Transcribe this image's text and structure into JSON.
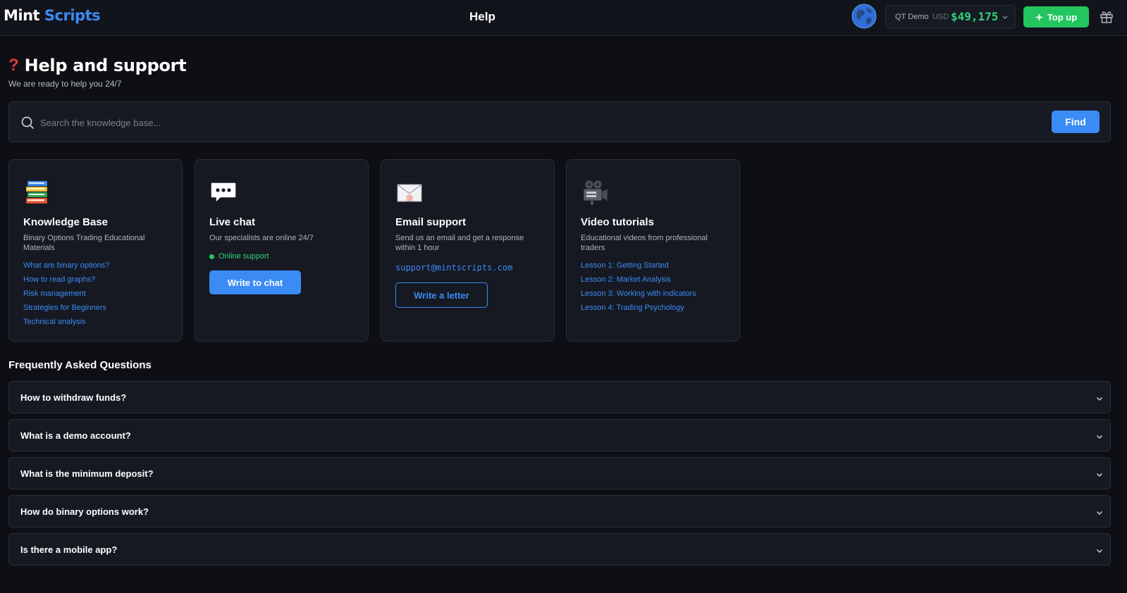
{
  "header": {
    "brand_part1": "Mint",
    "brand_part2": "Scripts",
    "page_title": "Help",
    "account_label": "QT Demo",
    "currency": "USD",
    "balance": "$49,175",
    "topup_label": "Top up"
  },
  "hero": {
    "title": "Help and support",
    "subtitle": "We are ready to help you 24/7"
  },
  "search": {
    "placeholder": "Search the knowledge base...",
    "button_label": "Find"
  },
  "cards": {
    "knowledge": {
      "title": "Knowledge Base",
      "description": "Binary Options Trading Educational Materials",
      "links": [
        "What are binary options?",
        "How to read graphs?",
        "Risk management",
        "Strategies for Beginners",
        "Technical analysis"
      ]
    },
    "chat": {
      "title": "Live chat",
      "description": "Our specialists are online 24/7",
      "status": "Online support",
      "button_label": "Write to chat"
    },
    "email": {
      "title": "Email support",
      "description": "Send us an email and get a response within 1 hour",
      "address": "support@mintscripts.com",
      "button_label": "Write a letter"
    },
    "video": {
      "title": "Video tutorials",
      "description": "Educational videos from professional traders",
      "links": [
        "Lesson 1: Getting Started",
        "Lesson 2: Market Analysis",
        "Lesson 3: Working with indicators",
        "Lesson 4: Trading Psychology"
      ]
    }
  },
  "faq": {
    "title": "Frequently Asked Questions",
    "items": [
      "How to withdraw funds?",
      "What is a demo account?",
      "What is the minimum deposit?",
      "How do binary options work?",
      "Is there a mobile app?"
    ]
  },
  "colors": {
    "accent": "#3b8bf5",
    "success": "#22c55e",
    "balance": "#2ed47a",
    "background": "#0e0f14",
    "card": "#161922"
  },
  "icons": {
    "header": [
      "globe-icon",
      "chevron-down-icon",
      "plus-icon",
      "gift-icon"
    ],
    "cards": [
      "books-icon",
      "speech-bubble-icon",
      "envelope-icon",
      "movie-camera-icon"
    ],
    "search": "search-icon",
    "hero": "question-mark-icon",
    "faq": "chevron-down-icon"
  }
}
